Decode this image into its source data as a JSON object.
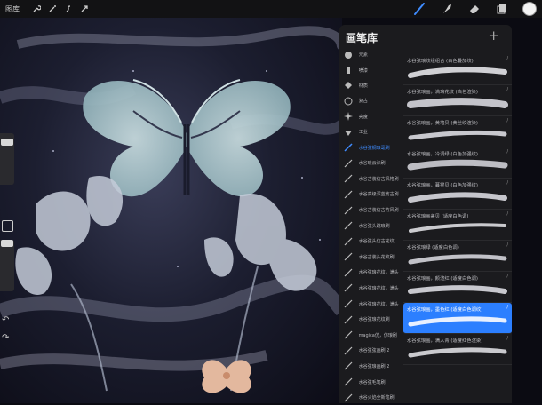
{
  "topbar": {
    "gallery_label": "图库",
    "left_tools": [
      "wrench-icon",
      "magic-wand-icon",
      "selection-icon",
      "transform-icon"
    ],
    "right_tools": [
      "brush-icon",
      "smudge-icon",
      "eraser-icon",
      "layers-icon"
    ],
    "current_color": "#f4f4f4"
  },
  "brush_library": {
    "title": "画笔库",
    "add_label": "+",
    "categories": [
      {
        "label": "元素",
        "icon": "element-icon"
      },
      {
        "label": "喷漆",
        "icon": "spray-icon"
      },
      {
        "label": "材质",
        "icon": "texture-icon"
      },
      {
        "label": "复古",
        "icon": "retro-icon"
      },
      {
        "label": "亮度",
        "icon": "luminance-icon"
      },
      {
        "label": "工业",
        "icon": "industrial-icon"
      }
    ],
    "sets": [
      "水谷弦钢琅毫刷",
      "水谷琅云涂刷",
      "水谷古装仿古风格刷",
      "水谷高级深蓝仿古刷",
      "水谷古装仿古竹风刷",
      "水谷弦头跳琅刷",
      "水谷弦头仿古花纹",
      "水谷古装头花纹刷",
      "水谷弦琅花纹，满头",
      "水谷弦琅花纹，满头",
      "水谷弦琅花纹，满头",
      "水谷弦琅花纹刷",
      "magica仿，仿琅刷",
      "水谷弦弦画刷 2",
      "水谷弦琅画刷 2",
      "水谷弦毛笔刷",
      "水谷火焰全新笔刷"
    ],
    "brushes": [
      {
        "name": "水谷弦琅纹组组合 (白色叠加纹)",
        "selected": false
      },
      {
        "name": "水谷弦琅画，满琅花纹 (白色渲染)",
        "selected": false
      },
      {
        "name": "水谷弦琅画，黄墙贝 (黄丝纹渲染)",
        "selected": false
      },
      {
        "name": "水谷弦琅画，冷调绿 (白色加强纹)",
        "selected": false
      },
      {
        "name": "水谷弦琅画，暮雾贝 (白色加强纹)",
        "selected": false
      },
      {
        "name": "水谷弦琅画盖贝 (适度白色调)",
        "selected": false
      },
      {
        "name": "水谷弦琅绿 (适度白色调)",
        "selected": false
      },
      {
        "name": "水谷弦琅画，颜渲红 (适度白色调)",
        "selected": false
      },
      {
        "name": "水谷弦琅画，墨色红 (适度白色调纹)",
        "selected": true
      },
      {
        "name": "水谷弦琅画，满人青 (适度红色渲染)",
        "selected": false
      }
    ]
  },
  "colors": {
    "accent": "#2c7fff",
    "panel_bg": "#1b1b1e",
    "butterfly": "#a9c7cc"
  }
}
